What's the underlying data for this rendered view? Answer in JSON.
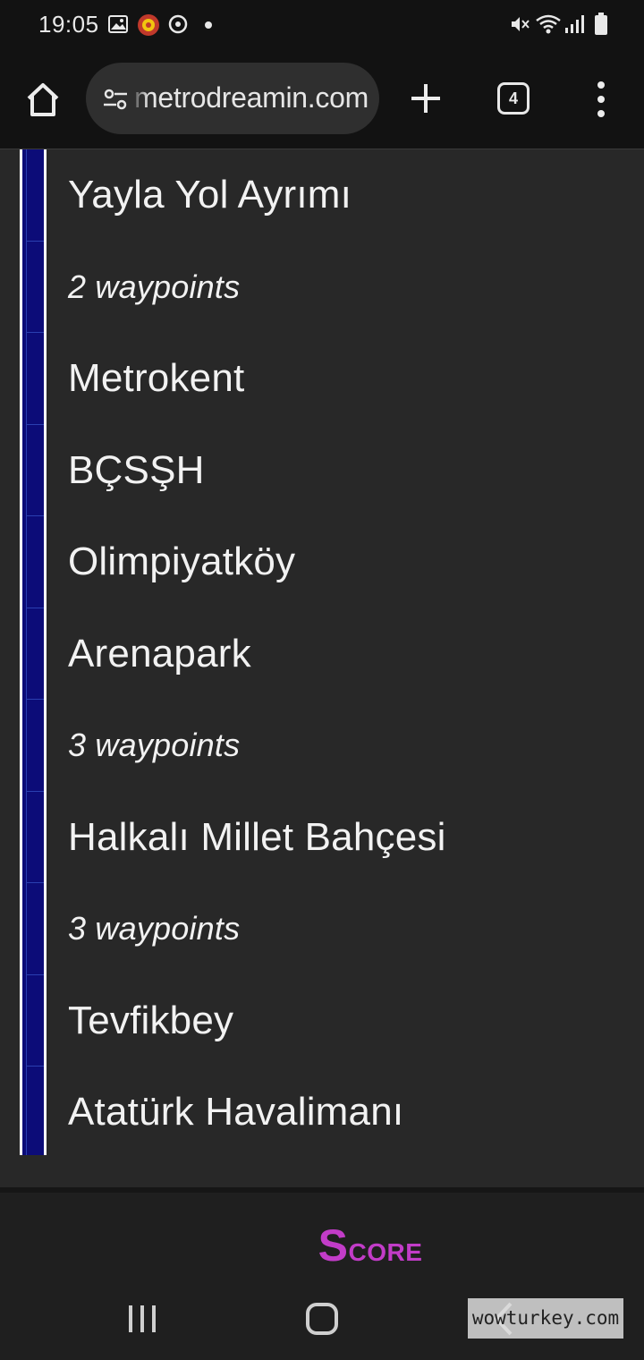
{
  "status_bar": {
    "time": "19:05"
  },
  "browser": {
    "url": "metrodreamin.com",
    "tab_count": "4"
  },
  "route": {
    "line_color": "#0c0c78",
    "stops": [
      {
        "label": "Yayla Yol Ayrımı",
        "kind": "station"
      },
      {
        "label": "2 waypoints",
        "kind": "waypoint"
      },
      {
        "label": "Metrokent",
        "kind": "station"
      },
      {
        "label": "BÇSŞH",
        "kind": "station"
      },
      {
        "label": "Olimpiyatköy",
        "kind": "station"
      },
      {
        "label": "Arenapark",
        "kind": "station"
      },
      {
        "label": "3 waypoints",
        "kind": "waypoint"
      },
      {
        "label": "Halkalı Millet Bahçesi",
        "kind": "station"
      },
      {
        "label": "3 waypoints",
        "kind": "waypoint"
      },
      {
        "label": "Tevfikbey",
        "kind": "station"
      },
      {
        "label": "Atatürk Havalimanı",
        "kind": "station"
      }
    ]
  },
  "score": {
    "label_initial": "S",
    "label_rest": "core",
    "color": "#c23cc8"
  },
  "watermark": {
    "text": "wowturkey.com"
  }
}
